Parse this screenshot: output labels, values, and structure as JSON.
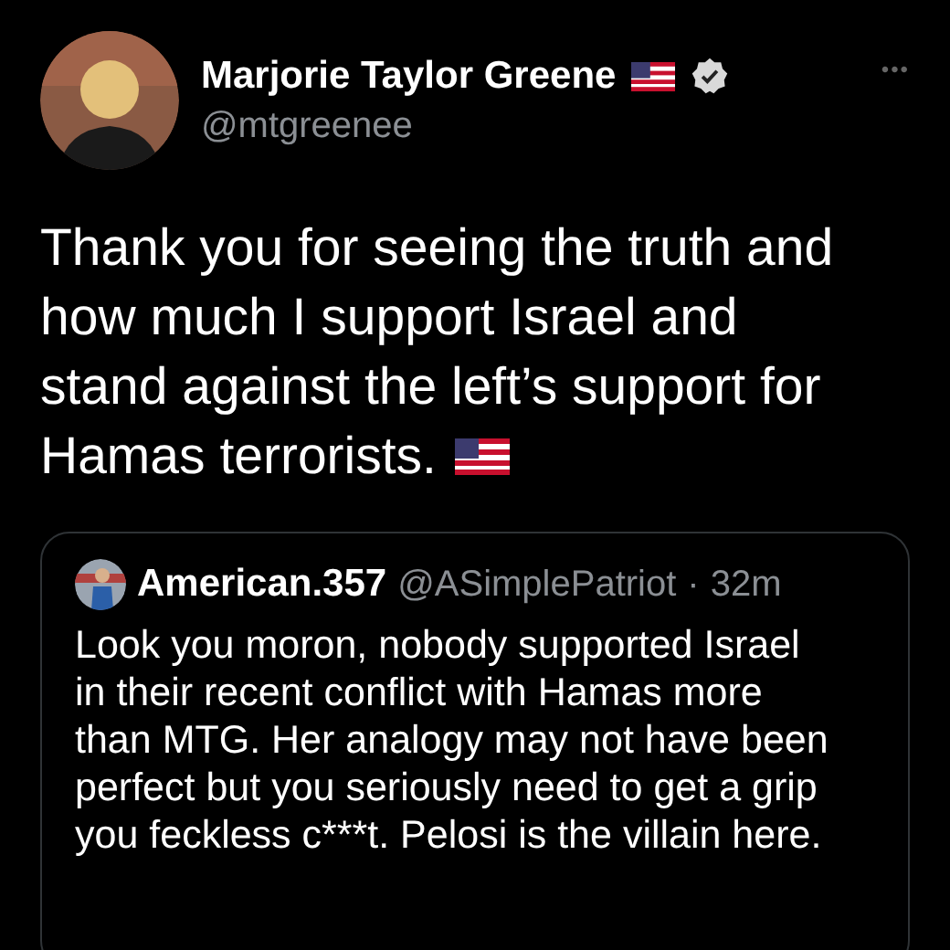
{
  "author": {
    "name": "Marjorie Taylor Greene",
    "handle": "@mtgreenee",
    "verified": true
  },
  "more_button": "•••",
  "tweet_text_lines": [
    "Thank you for seeing the truth and",
    "how much I support Israel and",
    "stand against the left’s support for",
    "Hamas terrorists."
  ],
  "quoted_tweet": {
    "name": "American.357",
    "handle": "@ASimplePatriot",
    "separator": "·",
    "time": "32m",
    "text": "Look you moron, nobody supported Israel in their recent conflict with Hamas more than MTG. Her analogy may not have been perfect but you seriously need to get a grip you feckless c***t. Pelosi is the villain here."
  }
}
